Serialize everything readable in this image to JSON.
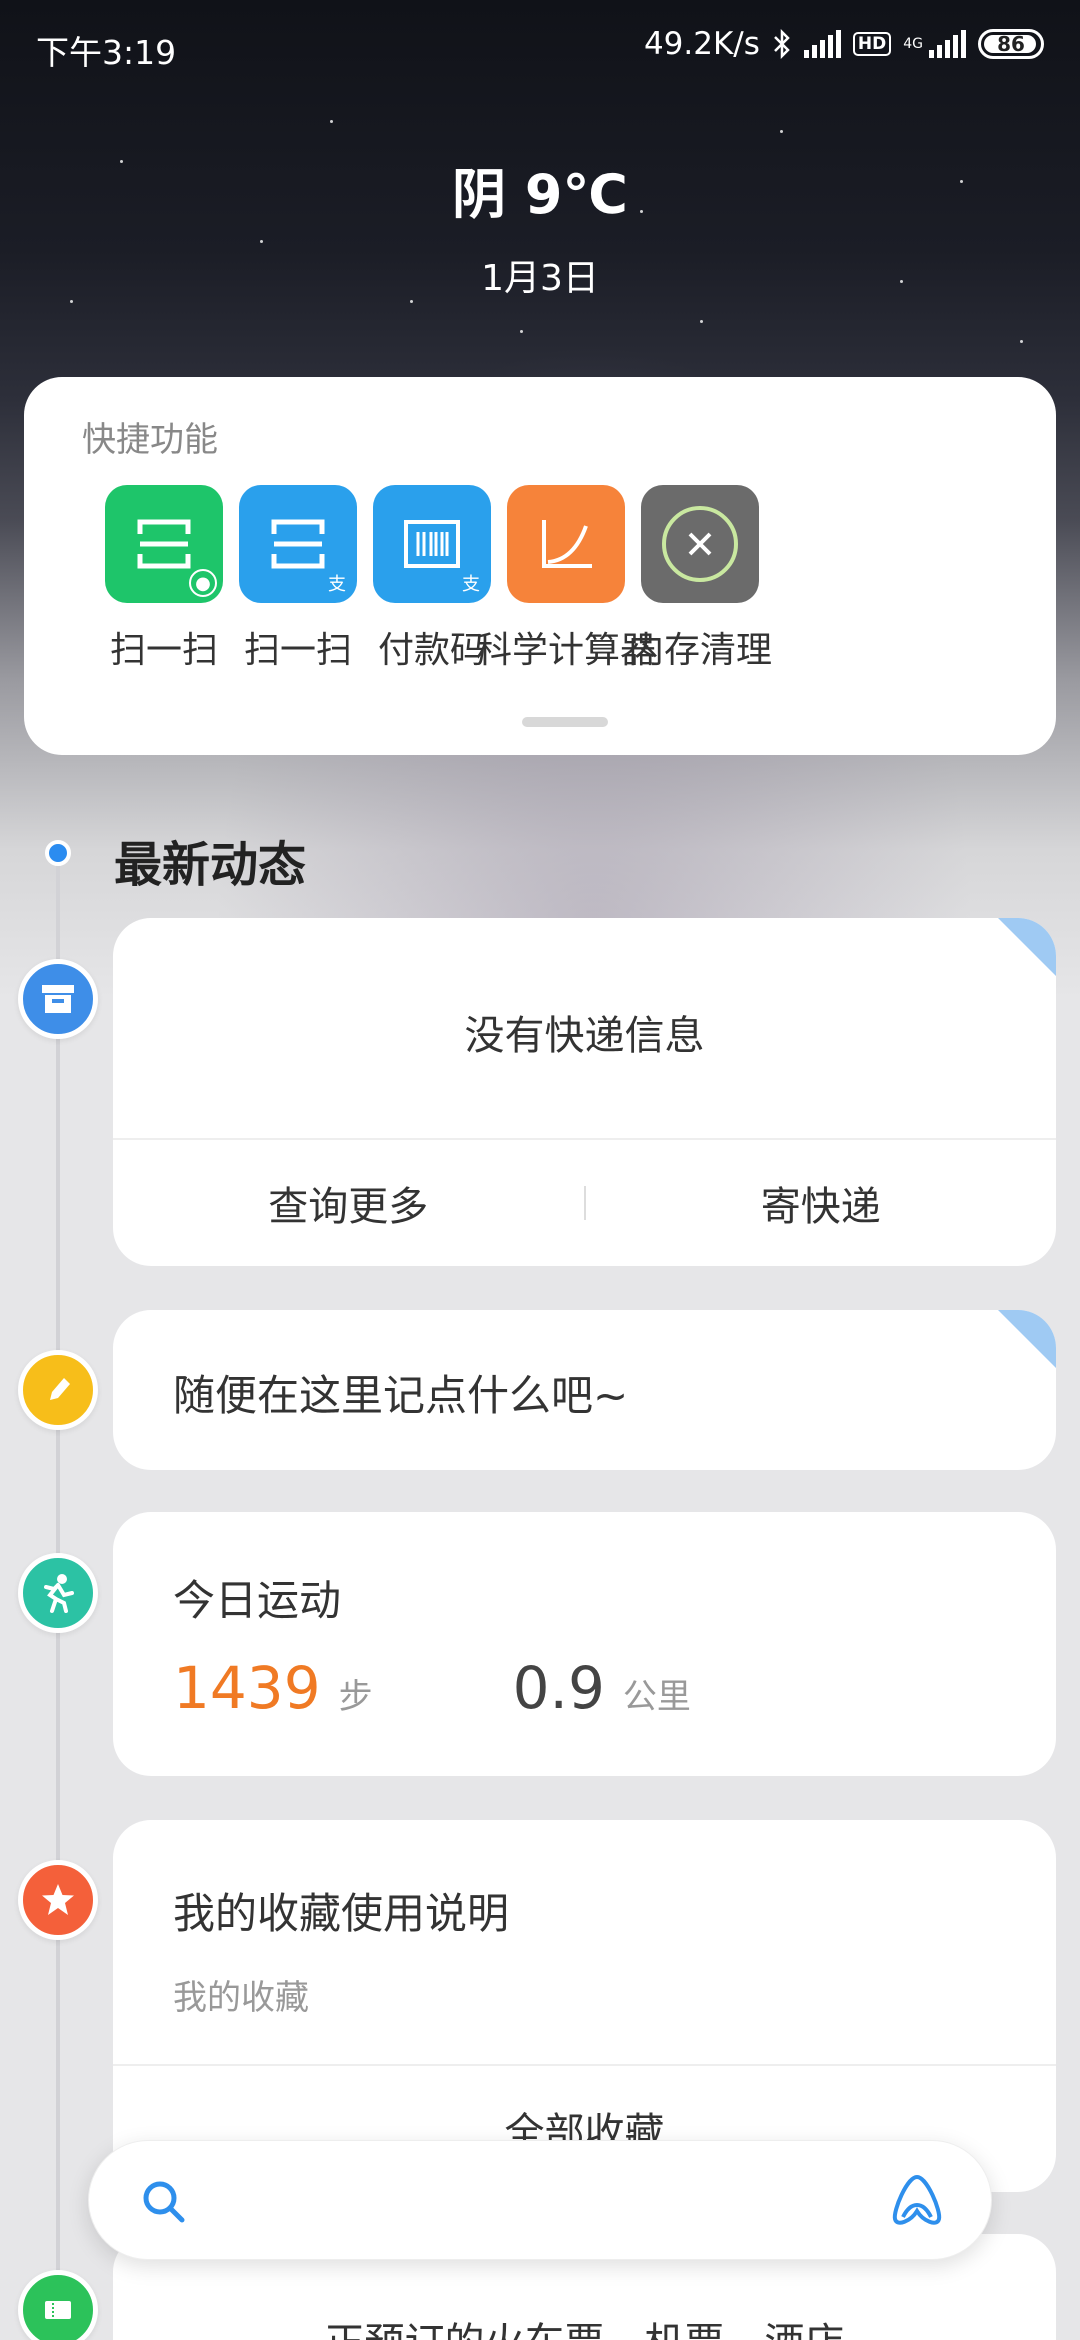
{
  "status_bar": {
    "time": "下午3:19",
    "net_speed": "49.2K/s",
    "hd": "HD",
    "network": "4G",
    "battery": "86"
  },
  "weather": {
    "temp": "阴 9℃",
    "date": "1月3日"
  },
  "quick": {
    "title": "快捷功能",
    "items": [
      {
        "label": "扫一扫",
        "icon": "wechat-scan-icon",
        "color": "#1ec56a"
      },
      {
        "label": "扫一扫",
        "icon": "alipay-scan-icon",
        "color": "#2aa0ec"
      },
      {
        "label": "付款码",
        "icon": "alipay-paycode-icon",
        "color": "#2aa0ec"
      },
      {
        "label": "科学计算器",
        "icon": "calculator-icon",
        "color": "#f6833a"
      },
      {
        "label": "内存清理",
        "icon": "memory-clean-icon",
        "color": "#6b6b6b"
      }
    ]
  },
  "feed": {
    "title": "最新动态",
    "express": {
      "message": "没有快递信息",
      "action_query": "查询更多",
      "action_send": "寄快递",
      "icon_color": "#3e8ee8"
    },
    "note": {
      "placeholder": "随便在这里记点什么吧~",
      "icon_color": "#f7be1a"
    },
    "sport": {
      "title": "今日运动",
      "steps": "1439",
      "steps_unit": "步",
      "distance": "0.9",
      "distance_unit": "公里",
      "icon_color": "#2cc2a4"
    },
    "favorites": {
      "title": "我的收藏使用说明",
      "subtitle": "我的收藏",
      "action_all": "全部收藏",
      "icon_color": "#f4603a"
    },
    "ticket": {
      "text": "正预订的火车票、机票、酒店",
      "icon_color": "#2cc25a"
    }
  },
  "search": {
    "placeholder": ""
  }
}
